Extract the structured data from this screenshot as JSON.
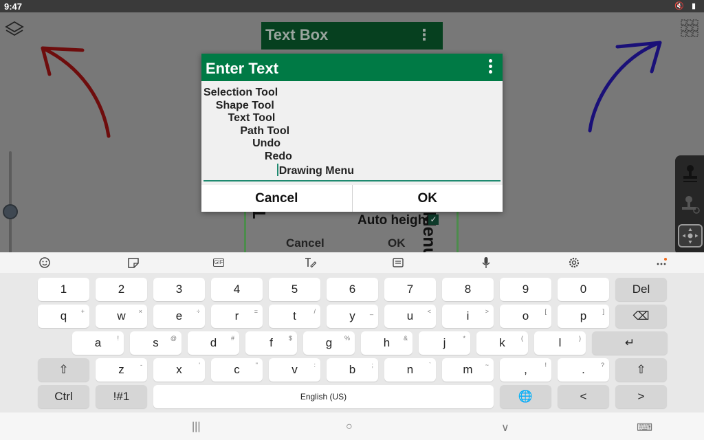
{
  "status": {
    "time": "9:47",
    "icons": "🔇 ▮"
  },
  "background": {
    "header_title": "Text Box",
    "autoheight_label": "Auto height",
    "vertical_left": "Tool",
    "vertical_right": "Menu",
    "cancel_label": "Cancel",
    "ok_label": "OK"
  },
  "dialog": {
    "title": "Enter Text",
    "lines": [
      "Selection Tool",
      "    Shape Tool",
      "        Text Tool",
      "            Path Tool",
      "                Undo",
      "                    Redo",
      "                        Drawing Menu"
    ],
    "cancel_label": "Cancel",
    "ok_label": "OK"
  },
  "keyboard": {
    "toolbar_icons": [
      "emoji-icon",
      "sticker-icon",
      "gif-icon",
      "handwriting-icon",
      "clipboard-icon",
      "mic-icon",
      "settings-icon",
      "more-icon"
    ],
    "gif_label": "GIF",
    "rows": [
      [
        {
          "k": "1"
        },
        {
          "k": "2"
        },
        {
          "k": "3"
        },
        {
          "k": "4"
        },
        {
          "k": "5"
        },
        {
          "k": "6"
        },
        {
          "k": "7"
        },
        {
          "k": "8"
        },
        {
          "k": "9"
        },
        {
          "k": "0"
        },
        {
          "k": "Del",
          "dark": true
        }
      ],
      [
        {
          "k": "q",
          "s": "+"
        },
        {
          "k": "w",
          "s": "×"
        },
        {
          "k": "e",
          "s": "÷"
        },
        {
          "k": "r",
          "s": "="
        },
        {
          "k": "t",
          "s": "/"
        },
        {
          "k": "y",
          "s": "_"
        },
        {
          "k": "u",
          "s": "<"
        },
        {
          "k": "i",
          "s": ">"
        },
        {
          "k": "o",
          "s": "["
        },
        {
          "k": "p",
          "s": "]"
        },
        {
          "k": "⌫",
          "dark": true
        }
      ],
      [
        {
          "k": "a",
          "s": "!"
        },
        {
          "k": "s",
          "s": "@"
        },
        {
          "k": "d",
          "s": "#"
        },
        {
          "k": "f",
          "s": "$"
        },
        {
          "k": "g",
          "s": "%"
        },
        {
          "k": "h",
          "s": "&"
        },
        {
          "k": "j",
          "s": "*"
        },
        {
          "k": "k",
          "s": "("
        },
        {
          "k": "l",
          "s": ")"
        },
        {
          "k": "↵",
          "dark": true
        }
      ],
      [
        {
          "k": "⇧",
          "dark": true
        },
        {
          "k": "z",
          "s": "-"
        },
        {
          "k": "x",
          "s": "'"
        },
        {
          "k": "c",
          "s": "\""
        },
        {
          "k": "v",
          "s": ":"
        },
        {
          "k": "b",
          "s": ";"
        },
        {
          "k": "n",
          "s": "`"
        },
        {
          "k": "m",
          "s": "~"
        },
        {
          "k": ",",
          "s": "!"
        },
        {
          "k": ".",
          "s": "?"
        },
        {
          "k": "⇧",
          "dark": true
        }
      ],
      [
        {
          "k": "Ctrl",
          "dark": true
        },
        {
          "k": "!#1",
          "dark": true
        },
        {
          "k": "English (US)",
          "space": true
        },
        {
          "k": "🌐",
          "dark": true
        },
        {
          "k": "<",
          "dark": true
        },
        {
          "k": ">",
          "dark": true
        }
      ]
    ]
  },
  "navbar": {
    "recents": "|||",
    "home": "○",
    "back": "∨",
    "keyboard": "⌨"
  }
}
